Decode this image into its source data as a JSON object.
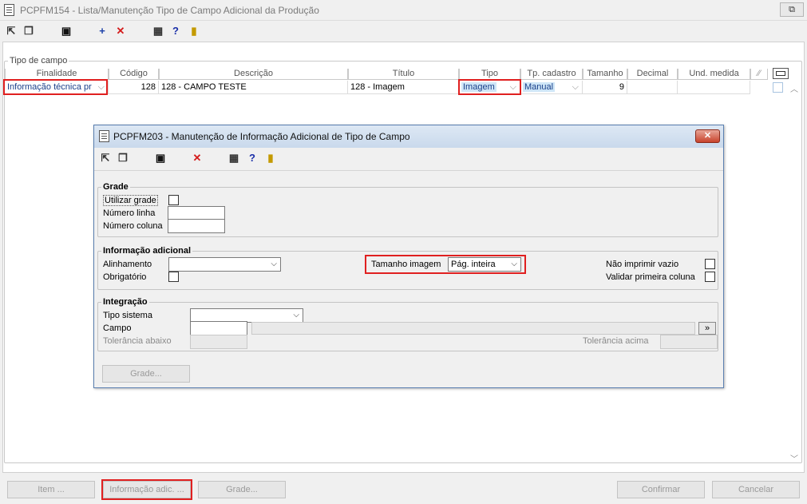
{
  "window": {
    "title": "PCPFM154 - Lista/Manutenção Tipo de Campo Adicional da Produção",
    "restore": "⧉"
  },
  "toolbar": {
    "icons": [
      "import-icon",
      "copy-icon",
      "save-icon",
      "add-icon",
      "delete-icon",
      "grid-icon",
      "help-icon",
      "exit-icon"
    ]
  },
  "main": {
    "group_label": "Tipo de campo",
    "columns": [
      "Finalidade",
      "Código",
      "Descrição",
      "Título",
      "Tipo",
      "Tp. cadastro",
      "Tamanho",
      "Decimal",
      "Und. medida"
    ],
    "row": {
      "finalidade": "Informação técnica pr",
      "codigo": "128",
      "descricao": "128 - CAMPO TESTE",
      "titulo": "128 - Imagem",
      "tipo": "Imagem",
      "tp_cadastro": "Manual",
      "tamanho": "9",
      "decimal": "",
      "und_medida": ""
    }
  },
  "dialog": {
    "title": "PCPFM203 - Manutenção de Informação Adicional de Tipo de Campo",
    "grade": {
      "legend": "Grade",
      "utilizar_grade": "Utilizar grade",
      "numero_linha": "Número linha",
      "numero_coluna": "Número coluna"
    },
    "info": {
      "legend": "Informação adicional",
      "alinhamento": "Alinhamento",
      "obrigatorio": "Obrigatório",
      "tamanho_imagem": "Tamanho imagem",
      "tamanho_imagem_value": "Pág. inteira",
      "nao_imprimir": "Não imprimir vazio",
      "validar_primeira": "Validar primeira coluna"
    },
    "integracao": {
      "legend": "Integração",
      "tipo_sistema": "Tipo sistema",
      "campo": "Campo",
      "tol_abaixo": "Tolerância abaixo",
      "tol_acima": "Tolerância acima",
      "browse": "»"
    },
    "grade_button": "Grade..."
  },
  "footer": {
    "item": "Item ...",
    "info_adic": "Informação adic. ...",
    "grade": "Grade...",
    "confirmar": "Confirmar",
    "cancelar": "Cancelar"
  },
  "colors": {
    "accent_red": "#e02020",
    "title_blue": "#c9d9ec"
  }
}
